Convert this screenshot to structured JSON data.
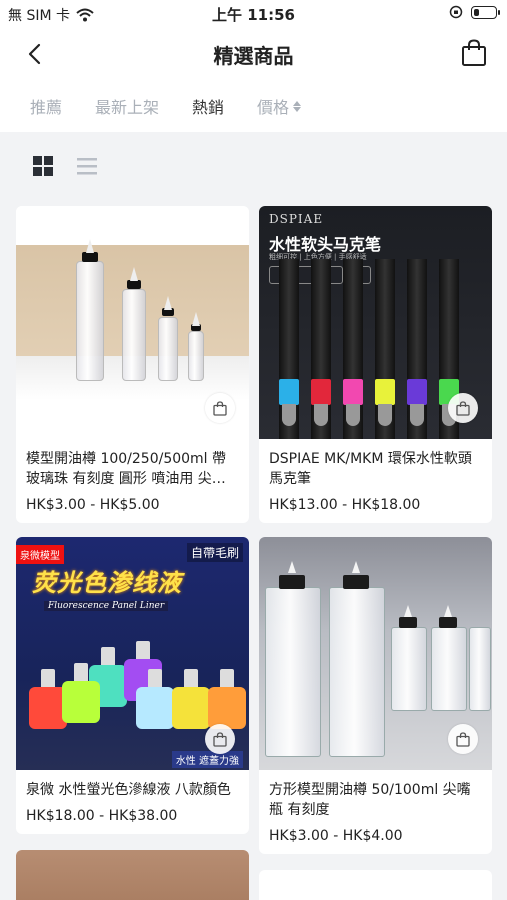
{
  "status_bar": {
    "carrier": "無 SIM 卡",
    "time": "上午 11:56",
    "battery_level": 0.25
  },
  "nav": {
    "title": "精選商品",
    "back_icon": "chevron-left-icon",
    "cart_icon": "shopping-bag-icon"
  },
  "sort_tabs": [
    {
      "label": "推薦",
      "active": false
    },
    {
      "label": "最新上架",
      "active": false
    },
    {
      "label": "熱銷",
      "active": true
    },
    {
      "label": "價格",
      "active": false
    }
  ],
  "view_modes": {
    "selected": "grid",
    "options": [
      "grid",
      "list"
    ]
  },
  "products": [
    {
      "name": "模型開油樽 100/250/500ml 帶玻璃珠 有刻度 圓形 噴油用 尖…",
      "price": "HK$3.00 - HK$5.00"
    },
    {
      "name": "DSPIAE MK/MKM 環保水性軟頭馬克筆",
      "price": "HK$13.00 - HK$18.00",
      "image_text": {
        "brand": "DSPIAE",
        "title": "水性软头马克笔",
        "subtitle": "粗细可控 | 上色方便 | 手感舒适"
      }
    },
    {
      "name": "泉微 水性螢光色滲線液 八款顏色",
      "price": "HK$18.00 - HK$38.00",
      "image_text": {
        "corner": "泉微模型",
        "tag": "自帶毛刷",
        "title": "荧光色渗线液",
        "english": "Fluorescence Panel Liner",
        "bottom": "水性 遮蓋力強"
      }
    },
    {
      "name": "方形模型開油樽 50/100ml 尖嘴瓶 有刻度",
      "price": "HK$3.00 - HK$4.00"
    }
  ],
  "colors": {
    "background": "#f2f3f5",
    "inactive_tab": "#aab0b8",
    "text": "#222222"
  }
}
